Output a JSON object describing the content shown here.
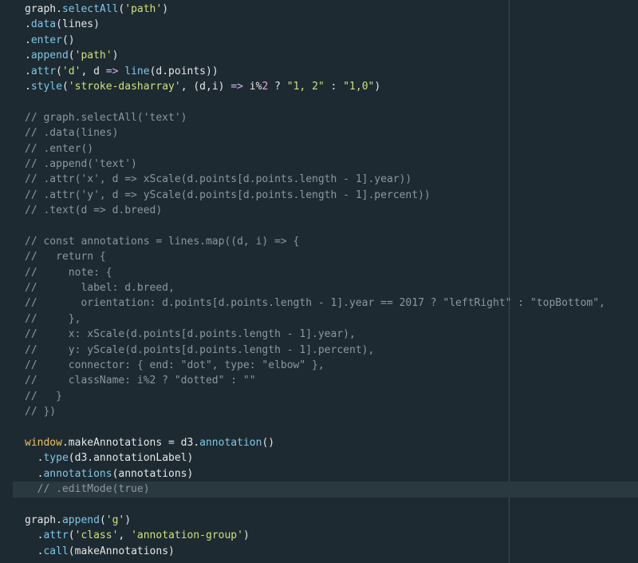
{
  "editor": {
    "language": "JavaScript",
    "active_line_index": 31,
    "lines": [
      [
        {
          "t": "graph",
          "c": "pl"
        },
        {
          "t": ".",
          "c": "pl"
        },
        {
          "t": "selectAll",
          "c": "fn"
        },
        {
          "t": "(",
          "c": "pl"
        },
        {
          "t": "'path'",
          "c": "str"
        },
        {
          "t": ")",
          "c": "pl"
        }
      ],
      [
        {
          "t": ".",
          "c": "pl"
        },
        {
          "t": "data",
          "c": "fn"
        },
        {
          "t": "(lines)",
          "c": "pl"
        }
      ],
      [
        {
          "t": ".",
          "c": "pl"
        },
        {
          "t": "enter",
          "c": "fn"
        },
        {
          "t": "()",
          "c": "pl"
        }
      ],
      [
        {
          "t": ".",
          "c": "pl"
        },
        {
          "t": "append",
          "c": "fn"
        },
        {
          "t": "(",
          "c": "pl"
        },
        {
          "t": "'path'",
          "c": "str"
        },
        {
          "t": ")",
          "c": "pl"
        }
      ],
      [
        {
          "t": ".",
          "c": "pl"
        },
        {
          "t": "attr",
          "c": "fn"
        },
        {
          "t": "(",
          "c": "pl"
        },
        {
          "t": "'d'",
          "c": "str"
        },
        {
          "t": ", d ",
          "c": "pl"
        },
        {
          "t": "=>",
          "c": "kw"
        },
        {
          "t": " ",
          "c": "pl"
        },
        {
          "t": "line",
          "c": "fn"
        },
        {
          "t": "(d.points))",
          "c": "pl"
        }
      ],
      [
        {
          "t": ".",
          "c": "pl"
        },
        {
          "t": "style",
          "c": "fn"
        },
        {
          "t": "(",
          "c": "pl"
        },
        {
          "t": "'stroke-dasharray'",
          "c": "str"
        },
        {
          "t": ", (d,i) ",
          "c": "pl"
        },
        {
          "t": "=>",
          "c": "kw"
        },
        {
          "t": " i%",
          "c": "pl"
        },
        {
          "t": "2",
          "c": "num"
        },
        {
          "t": " ? ",
          "c": "pl"
        },
        {
          "t": "\"1, 2\"",
          "c": "str"
        },
        {
          "t": " : ",
          "c": "pl"
        },
        {
          "t": "\"1,0\"",
          "c": "str"
        },
        {
          "t": ")",
          "c": "pl"
        }
      ],
      [],
      [
        {
          "t": "// graph.selectAll('text')",
          "c": "cmt"
        }
      ],
      [
        {
          "t": "// .data(lines)",
          "c": "cmt"
        }
      ],
      [
        {
          "t": "// .enter()",
          "c": "cmt"
        }
      ],
      [
        {
          "t": "// .append('text')",
          "c": "cmt"
        }
      ],
      [
        {
          "t": "// .attr('x', d => xScale(d.points[d.points.length - 1].year))",
          "c": "cmt"
        }
      ],
      [
        {
          "t": "// .attr('y', d => yScale(d.points[d.points.length - 1].percent))",
          "c": "cmt"
        }
      ],
      [
        {
          "t": "// .text(d => d.breed)",
          "c": "cmt"
        }
      ],
      [],
      [
        {
          "t": "// const annotations = lines.map((d, i) => {",
          "c": "cmt"
        }
      ],
      [
        {
          "t": "//   return {",
          "c": "cmt"
        }
      ],
      [
        {
          "t": "//     note: {",
          "c": "cmt"
        }
      ],
      [
        {
          "t": "//       label: d.breed,",
          "c": "cmt"
        }
      ],
      [
        {
          "t": "//       orientation: d.points[d.points.length - 1].year == 2017 ? \"leftRight\" : \"topBottom\",",
          "c": "cmt"
        }
      ],
      [
        {
          "t": "//     },",
          "c": "cmt"
        }
      ],
      [
        {
          "t": "//     x: xScale(d.points[d.points.length - 1].year),",
          "c": "cmt"
        }
      ],
      [
        {
          "t": "//     y: yScale(d.points[d.points.length - 1].percent),",
          "c": "cmt"
        }
      ],
      [
        {
          "t": "//     connector: { end: \"dot\", type: \"elbow\" },",
          "c": "cmt"
        }
      ],
      [
        {
          "t": "//     className: i%2 ? \"dotted\" : \"\"",
          "c": "cmt"
        }
      ],
      [
        {
          "t": "//   }",
          "c": "cmt"
        }
      ],
      [
        {
          "t": "// })",
          "c": "cmt"
        }
      ],
      [],
      [
        {
          "t": "window",
          "c": "glob"
        },
        {
          "t": ".makeAnnotations = d3.",
          "c": "pl"
        },
        {
          "t": "annotation",
          "c": "fn"
        },
        {
          "t": "()",
          "c": "pl"
        }
      ],
      [
        {
          "t": "  .",
          "c": "pl"
        },
        {
          "t": "type",
          "c": "fn"
        },
        {
          "t": "(d3.annotationLabel)",
          "c": "pl"
        }
      ],
      [
        {
          "t": "  .",
          "c": "pl"
        },
        {
          "t": "annotations",
          "c": "fn"
        },
        {
          "t": "(annotations)",
          "c": "pl"
        }
      ],
      [
        {
          "t": "  // .editMode(true)",
          "c": "cmt"
        }
      ],
      [],
      [
        {
          "t": "graph",
          "c": "pl"
        },
        {
          "t": ".",
          "c": "pl"
        },
        {
          "t": "append",
          "c": "fn"
        },
        {
          "t": "(",
          "c": "pl"
        },
        {
          "t": "'g'",
          "c": "str"
        },
        {
          "t": ")",
          "c": "pl"
        }
      ],
      [
        {
          "t": "  .",
          "c": "pl"
        },
        {
          "t": "attr",
          "c": "fn"
        },
        {
          "t": "(",
          "c": "pl"
        },
        {
          "t": "'class'",
          "c": "str"
        },
        {
          "t": ", ",
          "c": "pl"
        },
        {
          "t": "'annotation-group'",
          "c": "str"
        },
        {
          "t": ")",
          "c": "pl"
        }
      ],
      [
        {
          "t": "  .",
          "c": "pl"
        },
        {
          "t": "call",
          "c": "fn"
        },
        {
          "t": "(makeAnnotations)",
          "c": "pl"
        }
      ]
    ]
  },
  "colors": {
    "background": "#1d2a32",
    "plain": "#e6e6e6",
    "function": "#7fc7e8",
    "string": "#cfe07a",
    "keyword": "#d7b4f5",
    "number": "#f0a0e0",
    "comment": "#8e979c",
    "global": "#f0c15a"
  }
}
